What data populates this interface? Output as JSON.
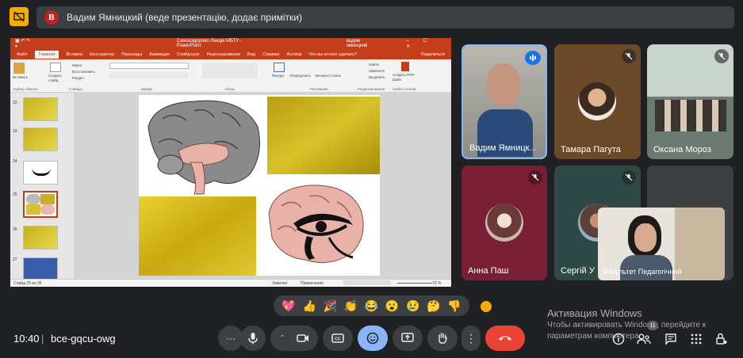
{
  "presenter": {
    "initial": "В",
    "text": "Вадим Ямницкий (веде презентацію, додає примітки)"
  },
  "ppt": {
    "window_title": "Самооздоровл Лекція МБТУ - PowerPoint",
    "user": "вадим ямницкий",
    "tabs": [
      "Файл",
      "Главная",
      "Вставка",
      "Конструктор",
      "Переходы",
      "Анимация",
      "Слайд-шоу",
      "Рецензирование",
      "Вид",
      "Справка",
      "Acrobat",
      "Что вы хотите сделать?"
    ],
    "share_label": "Поделиться",
    "ribbon": {
      "paste": "Вставить",
      "new_slide": "Создать слайд",
      "layout": "Макет",
      "reset": "Восстановить",
      "section": "Раздел",
      "clipboard": "Буфер обмена",
      "slides": "Слайды",
      "font": "Шрифт",
      "paragraph": "Абзац",
      "shapes": "Фигуры",
      "arrange": "Упорядочить",
      "quick_styles": "Экспресс-стили",
      "drawing": "Рисование",
      "find": "Найти",
      "replace": "Заменить",
      "select": "Выделить",
      "editing": "Редактирование",
      "create_pdf": "Создать PDF-файл",
      "adobe": "Adobe Acrobat"
    },
    "thumb_numbers": [
      "22",
      "23",
      "24",
      "25",
      "26",
      "27"
    ],
    "status": {
      "slide": "Слайд 25 из 36",
      "notes": "Заметки",
      "comments": "Примечания",
      "zoom": "73 %"
    }
  },
  "participants": [
    {
      "name": "Вадим Ямницк...",
      "color": "#8ab4f8"
    },
    {
      "name": "Тамара Пагута"
    },
    {
      "name": "Оксана Мороз"
    },
    {
      "name": "Анна Паш"
    },
    {
      "name": "Сергій У"
    },
    {
      "name": "Факультет Педагогічний"
    }
  ],
  "reactions": [
    "💖",
    "👍",
    "🎉",
    "👏",
    "😂",
    "😮",
    "😢",
    "🤔",
    "👎"
  ],
  "activation": {
    "title": "Активация Windows",
    "line1": "Чтобы активировать Windows, перейдите к",
    "line2": "параметрам компьютера."
  },
  "bottom": {
    "time": "10:40",
    "separator": "|",
    "code": "bce-gqcu-owg",
    "participants_count": "11"
  },
  "colors": {
    "accent": "#f9ab00",
    "end_call": "#ea4335",
    "reaction_active": "#8ab4f8",
    "ppt_red": "#c43e1c"
  }
}
